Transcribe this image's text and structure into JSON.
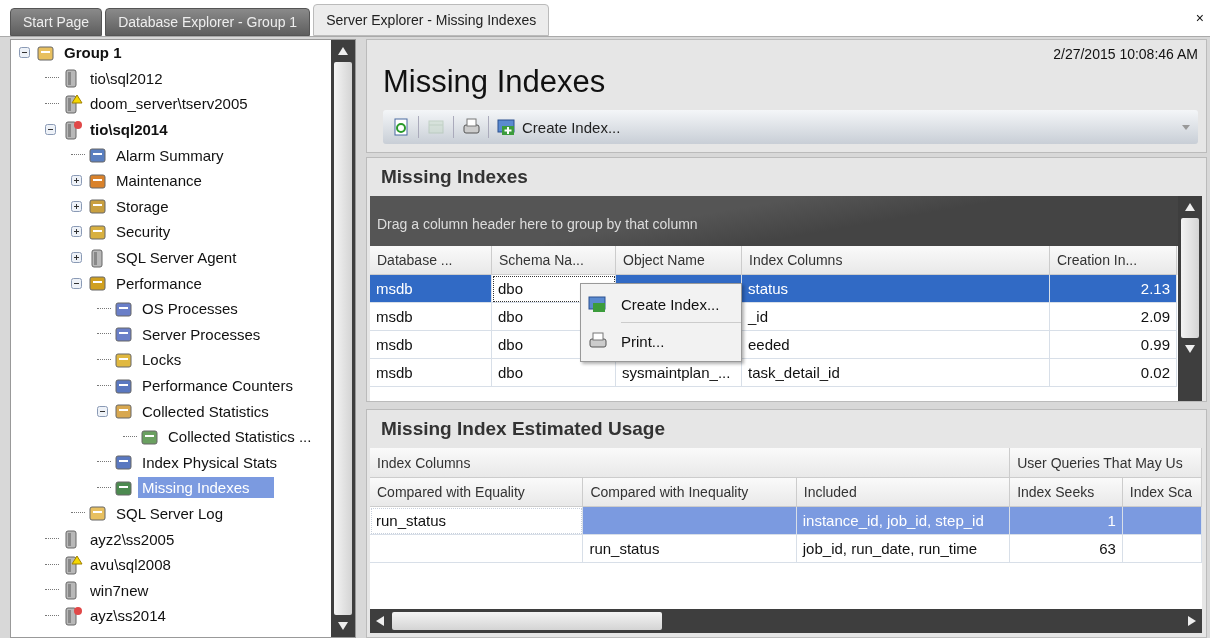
{
  "tabs": [
    {
      "label": "Start Page",
      "selected": false
    },
    {
      "label": "Database Explorer - Group 1",
      "selected": false
    },
    {
      "label": "Server Explorer - Missing Indexes",
      "selected": true
    }
  ],
  "close_label": "×",
  "tree": [
    {
      "label": "Group 1",
      "kind": "group",
      "bold": true,
      "selected": false,
      "expanded": true,
      "warning": false,
      "error": false,
      "children": [
        {
          "label": "tio\\sql2012",
          "kind": "server",
          "bold": false,
          "selected": false,
          "warning": false,
          "error": false
        },
        {
          "label": "doom_server\\tserv2005",
          "kind": "server",
          "bold": false,
          "selected": false,
          "warning": true,
          "error": false
        },
        {
          "label": "tio\\sql2014",
          "kind": "server",
          "bold": true,
          "selected": false,
          "expanded": true,
          "warning": false,
          "error": true,
          "children": [
            {
              "label": "Alarm Summary",
              "kind": "alarm",
              "bold": false,
              "selected": false,
              "warning": false,
              "error": false
            },
            {
              "label": "Maintenance",
              "kind": "maintenance",
              "bold": false,
              "selected": false,
              "expanded": false,
              "warning": false,
              "error": false
            },
            {
              "label": "Storage",
              "kind": "storage",
              "bold": false,
              "selected": false,
              "expanded": false,
              "warning": false,
              "error": false
            },
            {
              "label": "Security",
              "kind": "security",
              "bold": false,
              "selected": false,
              "expanded": false,
              "warning": false,
              "error": false
            },
            {
              "label": "SQL Server Agent",
              "kind": "agent",
              "bold": false,
              "selected": false,
              "expanded": false,
              "warning": false,
              "error": false
            },
            {
              "label": "Performance",
              "kind": "performance",
              "bold": false,
              "selected": false,
              "expanded": true,
              "warning": false,
              "error": false,
              "children": [
                {
                  "label": "OS Processes",
                  "kind": "processes",
                  "bold": false,
                  "selected": false,
                  "warning": false,
                  "error": false
                },
                {
                  "label": "Server Processes",
                  "kind": "processes",
                  "bold": false,
                  "selected": false,
                  "warning": false,
                  "error": false
                },
                {
                  "label": "Locks",
                  "kind": "locks",
                  "bold": false,
                  "selected": false,
                  "warning": false,
                  "error": false
                },
                {
                  "label": "Performance Counters",
                  "kind": "counters",
                  "bold": false,
                  "selected": false,
                  "warning": false,
                  "error": false
                },
                {
                  "label": "Collected Statistics",
                  "kind": "stats",
                  "bold": false,
                  "selected": false,
                  "expanded": true,
                  "warning": false,
                  "error": false,
                  "children": [
                    {
                      "label": "Collected Statistics ...",
                      "kind": "chart",
                      "bold": false,
                      "selected": false,
                      "warning": false,
                      "error": false
                    }
                  ]
                },
                {
                  "label": "Index Physical Stats",
                  "kind": "counters",
                  "bold": false,
                  "selected": false,
                  "warning": false,
                  "error": false
                },
                {
                  "label": "Missing Indexes",
                  "kind": "index",
                  "bold": false,
                  "selected": true,
                  "warning": false,
                  "error": false
                }
              ]
            },
            {
              "label": "SQL Server Log",
              "kind": "log",
              "bold": false,
              "selected": false,
              "warning": false,
              "error": false
            }
          ]
        },
        {
          "label": "ayz2\\ss2005",
          "kind": "server",
          "bold": false,
          "selected": false,
          "warning": false,
          "error": false
        },
        {
          "label": "avu\\sql2008",
          "kind": "server",
          "bold": false,
          "selected": false,
          "warning": true,
          "error": false
        },
        {
          "label": "win7new",
          "kind": "server",
          "bold": false,
          "selected": false,
          "warning": false,
          "error": false
        },
        {
          "label": "ayz\\ss2014",
          "kind": "server",
          "bold": false,
          "selected": false,
          "warning": false,
          "error": true
        }
      ]
    }
  ],
  "page": {
    "title": "Missing Indexes",
    "timestamp": "2/27/2015 10:08:46 AM"
  },
  "toolbar": [
    {
      "kind": "refresh",
      "disabled": false
    },
    {
      "kind": "columns",
      "disabled": true
    },
    {
      "kind": "print",
      "disabled": false
    },
    {
      "kind": "create",
      "label": "Create Index...",
      "disabled": false
    }
  ],
  "indexes": {
    "title": "Missing Indexes",
    "group_hint": "Drag a column header here to group by that column",
    "columns": [
      "Database ...",
      "Schema Na...",
      "Object Name",
      "Index Columns",
      "Creation In..."
    ],
    "rows": [
      {
        "cells": [
          {
            "text": "msdb",
            "focused": false
          },
          {
            "text": "dbo",
            "focused": true
          },
          {
            "focused": false
          },
          {
            "text": "status",
            "focused": false
          },
          {
            "text": "2.13",
            "focused": false
          }
        ],
        "selected": true
      },
      {
        "cells": [
          {
            "text": "msdb",
            "focused": false
          },
          {
            "text": "dbo",
            "focused": false
          },
          {},
          {
            "text": "_id",
            "focused": false
          },
          {
            "text": "2.09",
            "focused": false
          }
        ],
        "selected": false
      },
      {
        "cells": [
          {
            "text": "msdb",
            "focused": false
          },
          {
            "text": "dbo",
            "focused": false
          },
          {},
          {
            "text": "eeded",
            "focused": false
          },
          {
            "text": "0.99",
            "focused": false
          }
        ],
        "selected": false
      },
      {
        "cells": [
          {
            "text": "msdb",
            "focused": false
          },
          {
            "text": "dbo",
            "focused": false
          },
          {
            "text": "sysmaintplan_...",
            "focused": false
          },
          {
            "text": "task_detail_id",
            "focused": false
          },
          {
            "text": "0.02",
            "focused": false
          }
        ],
        "selected": false
      }
    ]
  },
  "context_menu": [
    {
      "kind": "create",
      "label": "Create Index..."
    },
    {
      "kind": "print",
      "label": "Print..."
    }
  ],
  "usage": {
    "title": "Missing Index Estimated Usage",
    "bands": [
      "Index Columns",
      "User Queries That May Us"
    ],
    "columns": [
      "Compared with Equality",
      "Compared with Inequality",
      "Included",
      "Index Seeks",
      "Index Sca"
    ],
    "rows": [
      {
        "cells": [
          {
            "text": "run_status",
            "focused": true
          },
          {
            "focused": false
          },
          {
            "text": "instance_id, job_id, step_id",
            "focused": false
          },
          {
            "text": "1",
            "focused": false
          },
          {
            "focused": false
          }
        ],
        "selected": true
      },
      {
        "cells": [
          {
            "focused": false
          },
          {
            "text": "run_status",
            "focused": false
          },
          {
            "text": "job_id, run_date, run_time",
            "focused": false
          },
          {
            "text": "63",
            "focused": false
          },
          {
            "focused": false
          }
        ],
        "selected": false
      }
    ]
  }
}
